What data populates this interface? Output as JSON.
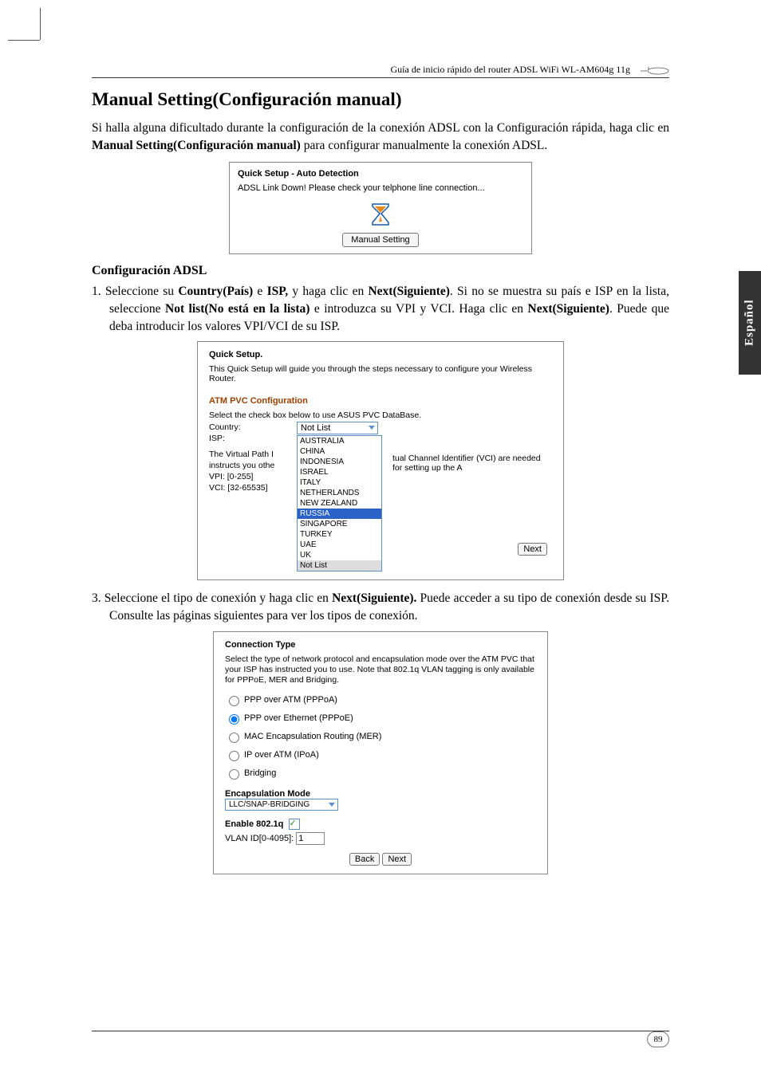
{
  "header": {
    "runner": "Guía de inicio rápido del router ADSL WiFi WL-AM604g 11g"
  },
  "langTab": "Español",
  "section": {
    "title": "Manual Setting(Configuración manual)",
    "intro_a": "Si halla alguna dificultado durante la configuración de la conexión ADSL con la Configuración rápida, haga clic en ",
    "intro_b_bold": "Manual Setting(Configuración manual)",
    "intro_c": " para configurar manualmente la conexión ADSL."
  },
  "shot1": {
    "title": "Quick Setup - Auto Detection",
    "msg": "ADSL Link Down! Please check your telphone line connection...",
    "btn": "Manual Setting"
  },
  "adsl": {
    "heading": "Configuración ADSL",
    "step1_num": "1.",
    "step1_a": "  Seleccione su ",
    "step1_b1": "Country(País)",
    "step1_c": " e ",
    "step1_b2": "ISP,",
    "step1_d": " y haga clic en ",
    "step1_b3": "Next(Siguiente)",
    "step1_e": ". Si no se muestra su país e ISP en la lista, seleccione ",
    "step1_b4": "Not list(No está en la lista)",
    "step1_f": " e introduzca su VPI y VCI. Haga clic en ",
    "step1_b5": "Next(Siguiente)",
    "step1_g": ". Puede que deba introducir los valores VPI/VCI de su ISP."
  },
  "shot2": {
    "title": "Quick Setup.",
    "intro": "This Quick Setup will guide you through the steps necessary to configure your Wireless Router.",
    "heading": "ATM PVC Configuration",
    "sub": "Select the check box below to use ASUS PVC DataBase.",
    "countryLabel": "Country:",
    "countryValue": "Not List",
    "ispLabel": "ISP:",
    "pathLine1": "The Virtual Path I",
    "pathLine2": "instructs you othe",
    "vpiLabel": "VPI: [0-255]",
    "vciLabel": "VCI: [32-65535]",
    "vciNote": "tual Channel Identifier (VCI) are needed for setting up the A",
    "countries": [
      "AUSTRALIA",
      "CHINA",
      "INDONESIA",
      "ISRAEL",
      "ITALY",
      "NETHERLANDS",
      "NEW ZEALAND",
      "RUSSIA",
      "SINGAPORE",
      "TURKEY",
      "UAE",
      "UK",
      "Not List"
    ],
    "nextBtn": "Next"
  },
  "step3": {
    "num": "3.",
    "a": "   Seleccione el tipo de conexión y haga clic en ",
    "b": "Next(Siguiente).",
    "c": " Puede acceder a su tipo de conexión desde su ISP. Consulte las páginas siguientes para ver los tipos de conexión."
  },
  "shot3": {
    "title": "Connection Type",
    "desc": "Select the type of network protocol and encapsulation mode over the ATM PVC that your ISP has instructed you to use. Note that 802.1q VLAN tagging is only available for PPPoE, MER and Bridging.",
    "opts": [
      "PPP over ATM (PPPoA)",
      "PPP over Ethernet (PPPoE)",
      "MAC Encapsulation Routing (MER)",
      "IP over ATM (IPoA)",
      "Bridging"
    ],
    "encapHeading": "Encapsulation Mode",
    "encapValue": "LLC/SNAP-BRIDGING",
    "enable8021q": "Enable 802.1q",
    "vlanLabel": "VLAN ID[0-4095]:",
    "vlanValue": "1",
    "backBtn": "Back",
    "nextBtn": "Next"
  },
  "pageNumber": "89"
}
